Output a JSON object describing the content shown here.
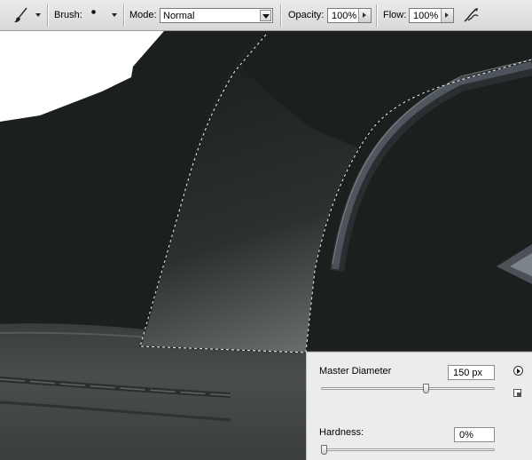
{
  "toolbar": {
    "brush_label": "Brush:",
    "mode_label": "Mode:",
    "mode_value": "Normal",
    "opacity_label": "Opacity:",
    "opacity_value": "100%",
    "flow_label": "Flow:",
    "flow_value": "100%"
  },
  "brush_popup": {
    "master_diameter_label": "Master Diameter",
    "master_diameter_value": "150 px",
    "master_diameter_slider_fraction": 0.61,
    "hardness_label": "Hardness:",
    "hardness_value": "0%",
    "hardness_slider_fraction": 0.0
  },
  "icons": {
    "tool_preset": "brush-icon",
    "airbrush": "airbrush-icon",
    "popup_menu": "flyout-arrow-icon",
    "new_preset": "new-preset-icon"
  },
  "colors": {
    "canvas_dark": "#1b1f1e",
    "toolbar_bg": "#e3e2e0",
    "popup_bg": "#ececec"
  }
}
